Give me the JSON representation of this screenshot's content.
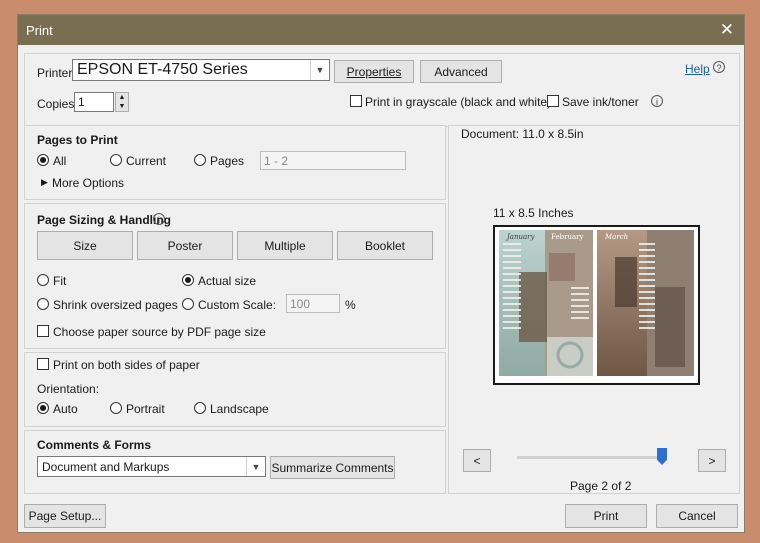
{
  "window": {
    "title": "Print",
    "close_glyph": "✕"
  },
  "printer": {
    "label": "Printer:",
    "selected": "EPSON ET-4750 Series",
    "properties_label": "Properties",
    "advanced_label": "Advanced",
    "help_label": "Help"
  },
  "copies": {
    "label": "Copies:",
    "value": "1"
  },
  "options": {
    "grayscale_label": "Print in grayscale (black and white)",
    "save_ink_label": "Save ink/toner"
  },
  "pages_to_print": {
    "heading": "Pages to Print",
    "all_label": "All",
    "current_label": "Current",
    "pages_label": "Pages",
    "pages_value": "1 - 2",
    "more_options_label": "More Options",
    "selected": "all"
  },
  "sizing": {
    "heading": "Page Sizing & Handling",
    "tabs": [
      "Size",
      "Poster",
      "Multiple",
      "Booklet"
    ],
    "fit_label": "Fit",
    "actual_label": "Actual size",
    "shrink_label": "Shrink oversized pages",
    "custom_label": "Custom Scale:",
    "custom_value": "100",
    "percent": "%",
    "paper_source_label": "Choose paper source by PDF page size",
    "selected": "actual"
  },
  "duplex": {
    "both_sides_label": "Print on both sides of paper",
    "orientation_label": "Orientation:",
    "auto_label": "Auto",
    "portrait_label": "Portrait",
    "landscape_label": "Landscape",
    "selected": "auto"
  },
  "comments": {
    "heading": "Comments & Forms",
    "selected": "Document and Markups",
    "summarize_label": "Summarize Comments"
  },
  "preview": {
    "document_size": "Document: 11.0 x 8.5in",
    "page_size": "11 x 8.5 Inches",
    "prev_glyph": "<",
    "next_glyph": ">",
    "page_indicator": "Page 2 of 2",
    "slider_position": 1.0,
    "thumb_months": [
      "January",
      "February",
      "March"
    ]
  },
  "footer": {
    "page_setup_label": "Page Setup...",
    "print_label": "Print",
    "cancel_label": "Cancel"
  },
  "colors": {
    "titlebar": "#7a6e52",
    "background": "#c98c6c",
    "slider_thumb": "#2f6fd0"
  }
}
